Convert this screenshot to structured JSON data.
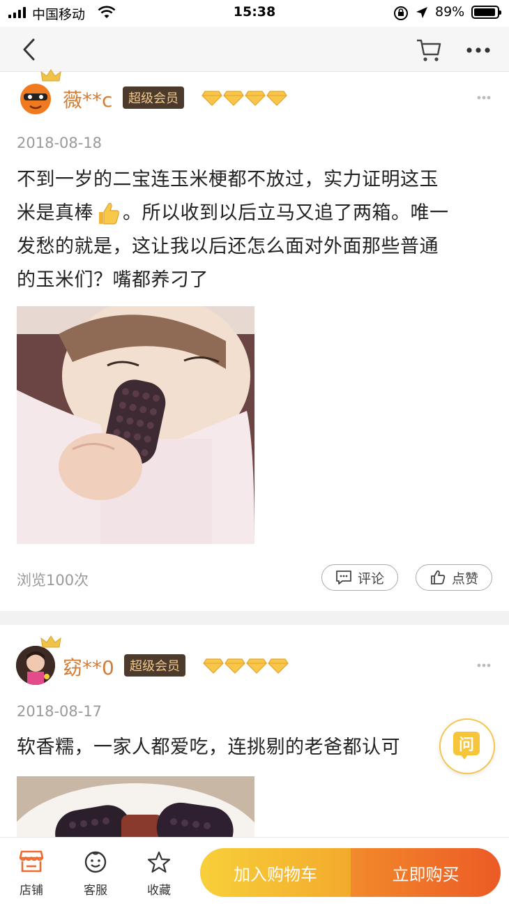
{
  "status_bar": {
    "carrier": "中国移动",
    "time": "15:38",
    "battery": "89%"
  },
  "nav": {
    "back_icon": "chevron-left-icon",
    "cart_icon": "cart-icon",
    "more_icon": "more-icon"
  },
  "reviews": [
    {
      "username": "薇**c",
      "badge": "超级会员",
      "date": "2018-08-18",
      "content_lines": [
        "不到一岁的二宝连玉米梗都不放过，实力证明这玉",
        "米是真棒",
        "。所以收到以后立马又追了两箱。唯一",
        "发愁的就是，这让我以后还怎么面对外面那些普通",
        "的玉米们？嘴都养刁了"
      ],
      "views": "浏览100次",
      "comment_label": "评论",
      "like_label": "点赞"
    },
    {
      "username": "窈**0",
      "badge": "超级会员",
      "date": "2018-08-17",
      "content": "软香糯，一家人都爱吃，连挑剔的老爸都认可"
    }
  ],
  "ask_button": "问",
  "bottom_bar": {
    "shop_label": "店铺",
    "service_label": "客服",
    "favorite_label": "收藏",
    "add_to_cart": "加入购物车",
    "buy_now": "立即购买"
  },
  "colors": {
    "accent": "#f3aa2c",
    "buy": "#ec5a25",
    "username": "#d27d36"
  }
}
